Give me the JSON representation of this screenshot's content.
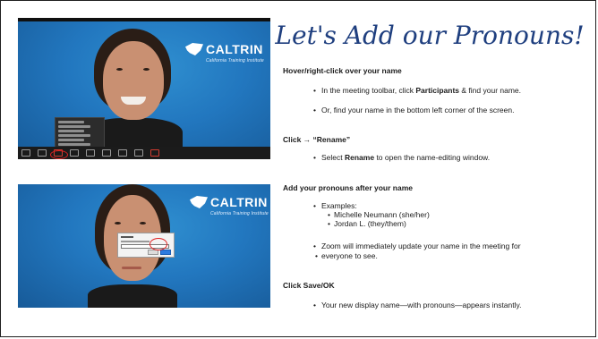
{
  "title": "Let's Add our Pronouns!",
  "logo": {
    "name": "CALTRIN",
    "tagline": "California Training Institute"
  },
  "sections": [
    {
      "heading": "Hover/right-click over your name",
      "bullets": [
        {
          "before": "In the meeting toolbar, click ",
          "bold": "Participants",
          "after": " & find your name."
        },
        {
          "before": "Or, find your name in the bottom left corner of the screen.",
          "bold": "",
          "after": ""
        }
      ]
    },
    {
      "heading": "Click → “Rename”",
      "bullets": [
        {
          "before": "Select ",
          "bold": "Rename",
          "after": " to open the name-editing window."
        }
      ]
    },
    {
      "heading": "Add your pronouns after your name",
      "examples_label": "Examples:",
      "examples": [
        "Michelle Neumann (she/her)",
        "Jordan L. (they/them)"
      ],
      "note_line1": "Zoom will immediately update your name in the meeting for",
      "note_line2": "everyone to see."
    },
    {
      "heading": "Click Save/OK",
      "bullets": [
        {
          "before": "Your new display name—with pronouns—appears instantly.",
          "bold": "",
          "after": ""
        }
      ]
    }
  ],
  "colors": {
    "title": "#1f3f7f",
    "zoom_background": "#2277bf",
    "highlight_ring": "#e02020"
  }
}
